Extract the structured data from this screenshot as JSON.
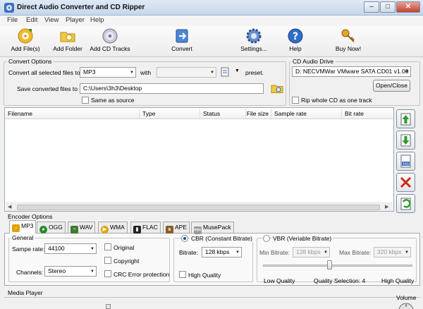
{
  "window": {
    "title": "Direct Audio Converter and CD Ripper"
  },
  "menu": [
    "File",
    "Edit",
    "View",
    "Player",
    "Help"
  ],
  "toolbar": {
    "add_files": "Add File(s)",
    "add_folder": "Add Folder",
    "add_cd_tracks": "Add CD Tracks",
    "convert": "Convert",
    "settings": "Settings...",
    "help": "Help",
    "buy_now": "Buy Now!"
  },
  "convert_options": {
    "title": "Convert Options",
    "convert_label": "Convert all selected files to",
    "format_value": "MP3",
    "with_label": "with",
    "preset_value": "",
    "preset_label": "preset.",
    "save_label": "Save converted files to",
    "save_path": "C:\\Users\\3h3\\Desktop",
    "same_as_source": "Same as source"
  },
  "cd_drive": {
    "title": "CD Audio Drive",
    "drive_value": "D: NECVMWar VMware SATA CD01 v1.00",
    "open_close": "Open/Close",
    "rip_whole_cd": "Rip whole CD as one track"
  },
  "file_list": {
    "columns": [
      "Filename",
      "Type",
      "Status",
      "File size",
      "Sample rate",
      "Bit rate"
    ]
  },
  "encoder": {
    "title": "Encoder Options",
    "tabs": [
      "MP3",
      "OGG",
      "WAV",
      "WMA",
      "FLAC",
      "APE",
      "MusePack"
    ],
    "general_title": "General",
    "sample_rate_label": "Sampe rate:",
    "sample_rate_value": "44100",
    "channels_label": "Channels:",
    "channels_value": "Stereo",
    "original": "Original",
    "copyright": "Copyright",
    "crc": "CRC Error protection",
    "cbr_label": "CBR (Constant Bitrate)",
    "bitrate_label": "Bitrate:",
    "bitrate_value": "128 kbps",
    "high_quality": "High Quality",
    "vbr_label": "VBR (Veriable Bitrate)",
    "min_bitrate_label": "Min Bitrate:",
    "min_bitrate_value": "128 kbps",
    "max_bitrate_label": "Max Bitrate:",
    "max_bitrate_value": "320 kbps",
    "low_quality": "Low Quality",
    "quality_selection": "Quality Selection:  4",
    "high_quality_label": "High Quality",
    "quality_level": 4
  },
  "media_player": {
    "title": "Media Player",
    "volume": "Volume"
  },
  "colors": {
    "title_bg": "#c6d7ec",
    "list_border": "#9aa9bd",
    "accent": "#1a4fb0"
  }
}
